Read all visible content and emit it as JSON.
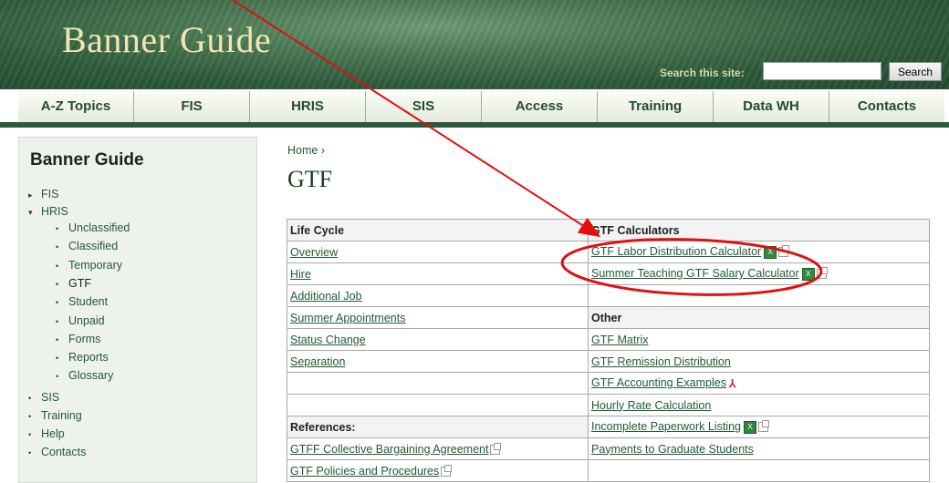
{
  "header": {
    "site_title": "Banner Guide",
    "search_label": "Search this site:",
    "search_value": "",
    "search_button": "Search"
  },
  "nav": {
    "tabs": [
      "A-Z Topics",
      "FIS",
      "HRIS",
      "SIS",
      "Access",
      "Training",
      "Data WH",
      "Contacts"
    ]
  },
  "sidebar": {
    "title": "Banner Guide",
    "items": [
      {
        "label": "FIS",
        "marker": "▸"
      },
      {
        "label": "HRIS",
        "marker": "▾"
      },
      {
        "label": "Unclassified",
        "marker": "•"
      },
      {
        "label": "Classified",
        "marker": "•"
      },
      {
        "label": "Temporary",
        "marker": "•"
      },
      {
        "label": "GTF",
        "marker": "•"
      },
      {
        "label": "Student",
        "marker": "•"
      },
      {
        "label": "Unpaid",
        "marker": "•"
      },
      {
        "label": "Forms",
        "marker": "•"
      },
      {
        "label": "Reports",
        "marker": "•"
      },
      {
        "label": "Glossary",
        "marker": "•"
      },
      {
        "label": "SIS",
        "marker": "•"
      },
      {
        "label": "Training",
        "marker": "•"
      },
      {
        "label": "Help",
        "marker": "•"
      },
      {
        "label": "Contacts",
        "marker": "•"
      }
    ]
  },
  "breadcrumb": {
    "home": "Home",
    "separator": "›"
  },
  "page_title": "GTF",
  "table": {
    "life_cycle_header": "Life Cycle",
    "calculators_header": "GTF Calculators",
    "other_header": "Other",
    "references_header": "References:",
    "left": {
      "overview": "Overview",
      "hire": "Hire",
      "additional_job": "Additional Job",
      "summer_appointments": "Summer Appointments",
      "status_change": "Status Change",
      "separation": "Separation",
      "gtff_agreement": "GTFF Collective Bargaining Agreement",
      "gtf_policies": "GTF Policies and Procedures"
    },
    "right": {
      "labor_calc": "GTF Labor Distribution Calculator",
      "summer_calc": "Summer Teaching GTF Salary Calculator",
      "gtf_matrix": "GTF Matrix",
      "remission": "GTF Remission Distribution",
      "accounting": "GTF Accounting Examples",
      "hourly_rate": "Hourly Rate Calculation",
      "incomplete": "Incomplete Paperwork Listing",
      "payments": "Payments to Graduate Students"
    }
  },
  "icons": {
    "excel": "excel-icon",
    "external": "external-link-icon",
    "pdf": "pdf-icon"
  },
  "colors": {
    "brand_green": "#2d5a3a",
    "link_green": "#1f5c33",
    "title_gold": "#f1e6b3",
    "annotation_red": "#e01010"
  }
}
